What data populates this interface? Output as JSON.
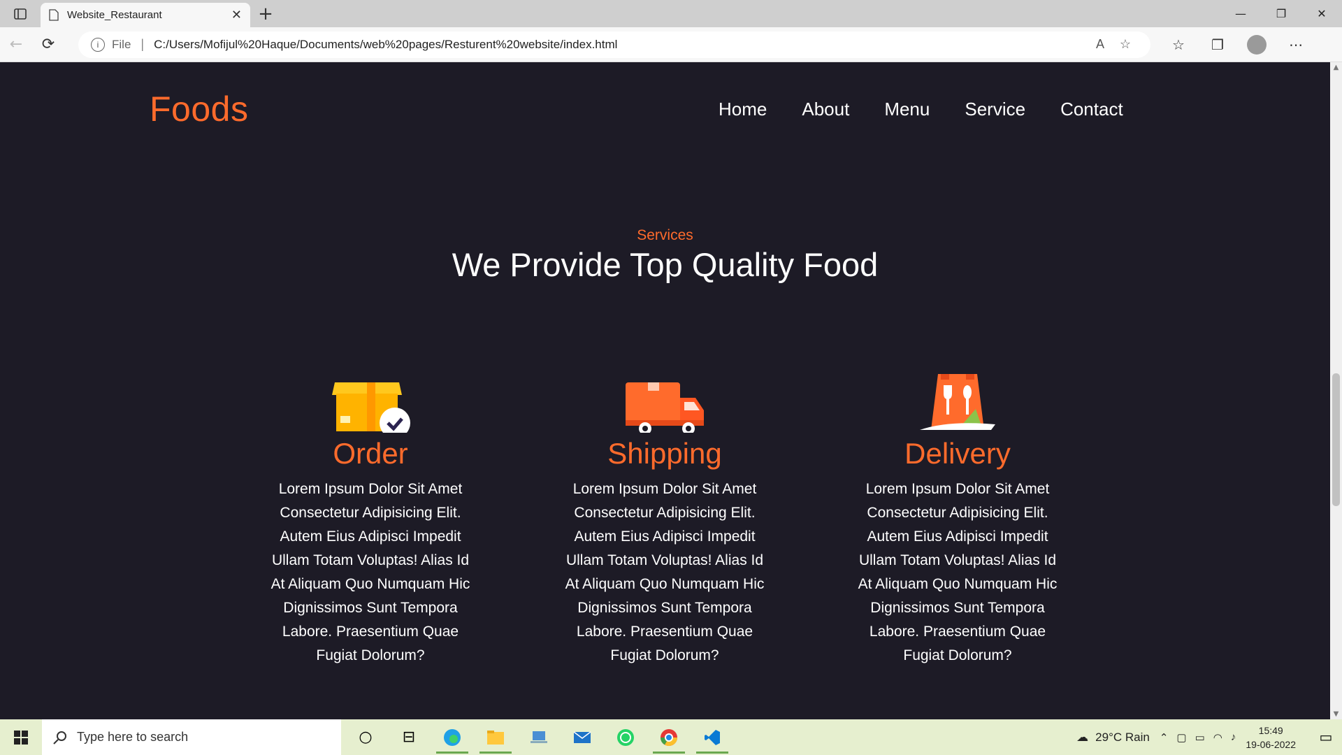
{
  "browser": {
    "tab_title": "Website_Restaurant",
    "tab_close": "✕",
    "new_tab": "+",
    "url_protocol": "File",
    "url": "C:/Users/Mofijul%20Haque/Documents/web%20pages/Resturent%20website/index.html",
    "window_controls": [
      "—",
      "❐",
      "✕"
    ]
  },
  "site": {
    "logo": "Foods",
    "nav": [
      "Home",
      "About",
      "Menu",
      "Service",
      "Contact"
    ],
    "section_subtitle": "Services",
    "section_title": "We Provide Top Quality Food",
    "cards": [
      {
        "title": "Order",
        "icon": "box-check-icon",
        "text": "Lorem Ipsum Dolor Sit Amet Consectetur Adipisicing Elit. Autem Eius Adipisci Impedit Ullam Totam Voluptas! Alias Id At Aliquam Quo Numquam Hic Dignissimos Sunt Tempora Labore. Praesentium Quae Fugiat Dolorum?"
      },
      {
        "title": "Shipping",
        "icon": "truck-icon",
        "text": "Lorem Ipsum Dolor Sit Amet Consectetur Adipisicing Elit. Autem Eius Adipisci Impedit Ullam Totam Voluptas! Alias Id At Aliquam Quo Numquam Hic Dignissimos Sunt Tempora Labore. Praesentium Quae Fugiat Dolorum?"
      },
      {
        "title": "Delivery",
        "icon": "food-bag-icon",
        "text": "Lorem Ipsum Dolor Sit Amet Consectetur Adipisicing Elit. Autem Eius Adipisci Impedit Ullam Totam Voluptas! Alias Id At Aliquam Quo Numquam Hic Dignissimos Sunt Tempora Labore. Praesentium Quae Fugiat Dolorum?"
      }
    ]
  },
  "taskbar": {
    "search_placeholder": "Type here to search",
    "weather": "29°C  Rain",
    "time": "15:49",
    "date": "19-06-2022"
  },
  "colors": {
    "accent": "#ff6b2c",
    "page_bg": "#1d1b26",
    "taskbar_bg": "#e6efcf"
  }
}
